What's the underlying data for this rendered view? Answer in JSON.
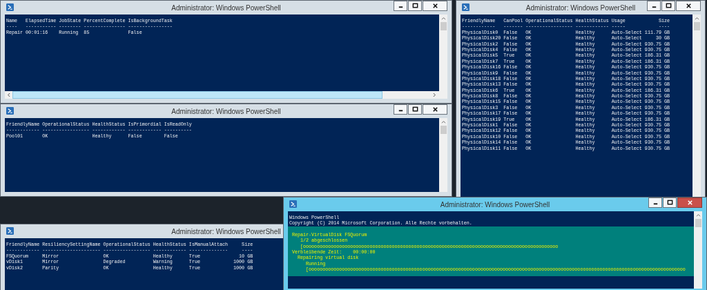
{
  "windows": [
    {
      "title": "Administrator: Windows PowerShell",
      "active": false,
      "lines": [
        "Name   ElapsedTime JobState PercentComplete IsBackgroundTask",
        "----   ----------- -------- --------------- ----------------",
        "Repair 00:01:16    Running  85              False"
      ]
    },
    {
      "title": "Administrator: Windows PowerShell",
      "active": false,
      "lines": [
        "FriendlyName   CanPool OperationalStatus HealthStatus Usage            Size",
        "------------   ------- ----------------- ------------ -----            ----",
        "PhysicalDisk0  False   OK                Healthy      Auto-Select 111.79 GB",
        "PhysicalDisk20 False   OK                Healthy      Auto-Select     30 GB",
        "PhysicalDisk2  False   OK                Healthy      Auto-Select 930.75 GB",
        "PhysicalDisk4  False   OK                Healthy      Auto-Select 930.75 GB",
        "PhysicalDisk5  True    OK                Healthy      Auto-Select 186.31 GB",
        "PhysicalDisk7  True    OK                Healthy      Auto-Select 186.31 GB",
        "PhysicalDisk16 False   OK                Healthy      Auto-Select 930.75 GB",
        "PhysicalDisk9  False   OK                Healthy      Auto-Select 930.75 GB",
        "PhysicalDisk18 False   OK                Healthy      Auto-Select 930.75 GB",
        "PhysicalDisk13 False   OK                Healthy      Auto-Select 930.75 GB",
        "PhysicalDisk6  True    OK                Healthy      Auto-Select 186.31 GB",
        "PhysicalDisk8  False   OK                Healthy      Auto-Select 930.75 GB",
        "PhysicalDisk15 False   OK                Healthy      Auto-Select 930.75 GB",
        "PhysicalDisk3  False   OK                Healthy      Auto-Select 930.75 GB",
        "PhysicalDisk17 False   OK                Healthy      Auto-Select 930.75 GB",
        "PhysicalDisk19 True    OK                Healthy      Auto-Select 186.31 GB",
        "PhysicalDisk1  False   OK                Healthy      Auto-Select 930.75 GB",
        "PhysicalDisk12 False   OK                Healthy      Auto-Select 930.75 GB",
        "PhysicalDisk10 False   OK                Healthy      Auto-Select 930.75 GB",
        "PhysicalDisk14 False   OK                Healthy      Auto-Select 930.75 GB",
        "PhysicalDisk11 False   OK                Healthy      Auto-Select 930.75 GB"
      ]
    },
    {
      "title": "Administrator: Windows PowerShell",
      "active": false,
      "lines": [
        "FriendlyName OperationalStatus HealthStatus IsPrimordial IsReadOnly",
        "------------ ----------------- ------------ ------------ ----------",
        "Pool01       OK                Healthy      False        False"
      ]
    },
    {
      "title": "Administrator: Windows PowerShell",
      "active": false,
      "lines": [
        "FriendlyName ResiliencySettingName OperationalStatus HealthStatus IsManualAttach     Size",
        "------------ --------------------- ----------------- ------------ --------------     ----",
        "FSQuorum     Mirror                OK                Healthy      True              10 GB",
        "vDisk1       Mirror                Degraded          Warning      True            1000 GB",
        "vDisk2       Parity                OK                Healthy      True            1000 GB"
      ]
    },
    {
      "title": "Administrator: Windows PowerShell",
      "active": true,
      "lines": [
        "Windows PowerShell",
        "Copyright (C) 2014 Microsoft Corporation. Alle Rechte vorbehalten."
      ],
      "progress": {
        "lines": [
          " Repair-VirtualDisk FSQuorum",
          "    1/2 abgeschlossen",
          "    [oooooooooooooooooooooooooooooooooooooooooooooooooooooooooooooooooooooooooooooooooooooooooooo",
          " Verbleibende Zeit:    00:00:00",
          "   Repairing virtual disk",
          "      Running",
          "      [oooooooooooooooooooooooooooooooooooooooooooooooooooooooooooooooooooooooooooooooooooooooooooooooooooooooooooooooooooooooooooooooooooooooo"
        ]
      }
    }
  ]
}
